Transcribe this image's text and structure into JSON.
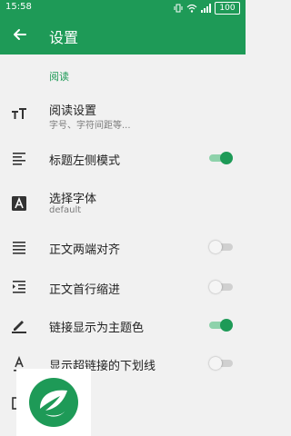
{
  "status_bar": {
    "time": "15:58",
    "battery": "100"
  },
  "toolbar": {
    "title": "设置",
    "back_icon": "arrow-back-icon"
  },
  "section": {
    "title": "阅读"
  },
  "settings": [
    {
      "title": "阅读设置",
      "subtitle": "字号、字符间距等...",
      "icon": "text-size-icon"
    },
    {
      "title": "标题左侧模式",
      "icon": "align-left-icon",
      "switch": true
    },
    {
      "title": "选择字体",
      "subtitle": "default",
      "icon": "font-a-icon"
    },
    {
      "title": "正文两端对齐",
      "icon": "align-justify-icon",
      "switch": false
    },
    {
      "title": "正文首行缩进",
      "icon": "indent-icon",
      "switch": false
    },
    {
      "title": "链接显示为主题色",
      "icon": "pen-icon",
      "switch": true
    },
    {
      "title": "显示超链接的下划线",
      "icon": "underline-a-icon",
      "switch": false
    }
  ],
  "colors": {
    "primary": "#1e9a57",
    "background": "#f1f1f1"
  }
}
